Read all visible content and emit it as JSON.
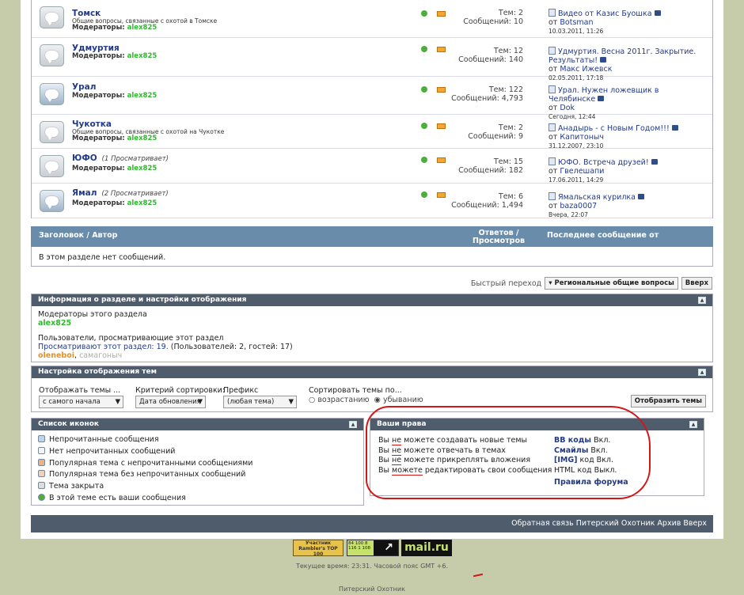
{
  "forums": [
    {
      "title": "Томск",
      "viewing": "",
      "desc": "Общие вопросы, связанные с охотой в Томске",
      "mods_label": "Модераторы:",
      "mod": "alex825",
      "new": false,
      "topics": "Тем: 2",
      "posts": "Сообщений: 10",
      "last_title": "Видео от Казис Буошка",
      "last_from": "от",
      "last_user": "Botsman",
      "last_date": "10.03.2011, 11:26"
    },
    {
      "title": "Удмуртия",
      "viewing": "",
      "desc": "",
      "mods_label": "Модераторы:",
      "mod": "alex825",
      "new": false,
      "topics": "Тем: 12",
      "posts": "Сообщений: 140",
      "last_title": "Удмуртия. Весна 2011г. Закрытие. Результаты!",
      "last_from": "от",
      "last_user": "Макс Ижевск",
      "last_date": "02.05.2011, 17:18"
    },
    {
      "title": "Урал",
      "viewing": "",
      "desc": "",
      "mods_label": "Модераторы:",
      "mod": "alex825",
      "new": true,
      "topics": "Тем: 122",
      "posts": "Сообщений: 4,793",
      "last_title": "Урал. Нужен ложевщик в Челябинске",
      "last_from": "от",
      "last_user": "Dok",
      "last_date": "Сегодня, 12:44"
    },
    {
      "title": "Чукотка",
      "viewing": "",
      "desc": "Общие вопросы, связанные с охотой на Чукотке",
      "mods_label": "Модераторы:",
      "mod": "alex825",
      "new": false,
      "topics": "Тем: 2",
      "posts": "Сообщений: 9",
      "last_title": "Анадырь - с Новым Годом!!!",
      "last_from": "от",
      "last_user": "Капитоныч",
      "last_date": "31.12.2007, 23:10"
    },
    {
      "title": "ЮФО",
      "viewing": "(1 Просматривает)",
      "desc": "",
      "mods_label": "Модераторы:",
      "mod": "alex825",
      "new": false,
      "topics": "Тем: 15",
      "posts": "Сообщений: 182",
      "last_title": "ЮФО. Встреча друзей!",
      "last_from": "от",
      "last_user": "Гвелешапи",
      "last_date": "17.06.2011, 14:29"
    },
    {
      "title": "Ямал",
      "viewing": "(2 Просматривает)",
      "desc": "",
      "mods_label": "Модераторы:",
      "mod": "alex825",
      "new": true,
      "topics": "Тем: 6",
      "posts": "Сообщений: 1,494",
      "last_title": "Ямальская курилка",
      "last_from": "от",
      "last_user": "baza0007",
      "last_date": "Вчера, 22:07"
    }
  ],
  "threads": {
    "col_title": "Заголовок / Автор",
    "col_replies": "Ответов / Просмотров",
    "col_last": "Последнее сообщение от",
    "empty": "В этом разделе нет сообщений."
  },
  "quick": {
    "label": "Быстрый переход",
    "select": "▾ Региональные общие вопросы",
    "go": "Вверх"
  },
  "info": {
    "title": "Информация о разделе и настройки отображения",
    "mods_heading": "Модераторы этого раздела",
    "mod": "alex825",
    "users_heading": "Пользователи, просматривающие этот раздел",
    "viewing_link": "Просматривают этот раздел: 19.",
    "viewing_rest": "(Пользователей: 2, гостей: 17)",
    "user1": "oleneboi",
    "user2": "самагоныч"
  },
  "display": {
    "title": "Настройка отображения тем",
    "show_label": "Отображать темы ...",
    "show_value": "с самого начала",
    "sort_label": "Критерий сортировки:",
    "sort_value": "Дата обновления",
    "prefix_label": "Префикс",
    "prefix_value": "(любая тема)",
    "order_label": "Сортировать темы по...",
    "asc": "возрастанию",
    "desc": "убыванию",
    "button": "Отобразить темы"
  },
  "icons": {
    "title": "Список иконок",
    "items": [
      "Непрочитанные сообщения",
      "Нет непрочитанных сообщений",
      "Популярная тема с непрочитанными сообщениями",
      "Популярная тема без непрочитанных сообщений",
      "Тема закрыта",
      "В этой теме есть ваши сообщения"
    ]
  },
  "rights": {
    "title": "Ваши права",
    "lines": [
      [
        "Вы ",
        "не",
        " можете создавать новые темы"
      ],
      [
        "Вы ",
        "не",
        " можете отвечать в темах"
      ],
      [
        "Вы ",
        "не",
        " можете прикреплять вложения"
      ],
      [
        "Вы ",
        "можете",
        " редактировать свои сообщения"
      ]
    ],
    "codes": [
      [
        "BB коды",
        "Вкл."
      ],
      [
        "Смайлы",
        "Вкл."
      ],
      [
        "[IMG]",
        "код Вкл."
      ],
      [
        "HTML",
        "код Выкл."
      ]
    ],
    "rules": "Правила форума"
  },
  "footer": {
    "links": "Обратная связь  Питерский Охотник  Архив  Вверх"
  },
  "badges": {
    "rambler": "Участник Rambler's TOP 100",
    "counter": "84 100 8 116 1 108",
    "mail": "mail.ru"
  },
  "time": {
    "text": "Текущее время: 23:31. Часовой пояс GMT +6."
  },
  "site": "Питерский Охотник",
  "colors": {
    "accent": "#4e5c6c",
    "header": "#6a8cab",
    "link": "#223a8a",
    "moderator": "#2fb82f",
    "annotation": "#d01818"
  }
}
